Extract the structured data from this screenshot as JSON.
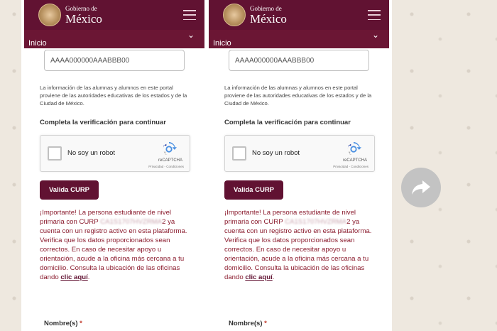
{
  "panels": [
    {
      "header": {
        "brand_small": "Gobierno de",
        "brand_big": "México"
      },
      "nav": {
        "label": "Inicio"
      },
      "curp_field": {
        "value": "AAAA000000AAABBB00"
      },
      "info_text": "La información de las alumnas y alumnos en este portal proviene de las autoridades educativas de los estados y de la Ciudad de México.",
      "verify_title": "Completa la verificación para continuar",
      "recaptcha": {
        "label": "No soy un robot",
        "brand": "reCAPTCHA",
        "links": "Privacidad - Condiciones"
      },
      "button": {
        "label": "Valida CURP"
      },
      "notice": {
        "part1": "¡Importante! La persona estudiante de nivel primaria con CURP ",
        "curp_blurred": "CA1S1707HVZRMA",
        "curp_tail": "2",
        "part2": " ya cuenta con un registro activo en esta plataforma. Verifica que los datos proporcionados sean correctos. En caso de necesitar apoyo u orientación, acude a la oficina más cercana a tu domicilio. Consulta la ubicación de las oficinas dando ",
        "link": "clic aquí",
        "end": "."
      },
      "form": {
        "nombre_label": "Nombre(s)",
        "required_mark": "*"
      }
    },
    {
      "header": {
        "brand_small": "Gobierno de",
        "brand_big": "México"
      },
      "nav": {
        "label": "Inicio"
      },
      "curp_field": {
        "value": "AAAA000000AAABBB00"
      },
      "info_text": "La información de las alumnas y alumnos en este portal proviene de las autoridades educativas de los estados y de la Ciudad de México.",
      "verify_title": "Completa la verificación para continuar",
      "recaptcha": {
        "label": "No soy un robot",
        "brand": "reCAPTCHA",
        "links": "Privacidad - Condiciones"
      },
      "button": {
        "label": "Valida CURP"
      },
      "notice": {
        "part1": "¡Importante! La persona estudiante de nivel primaria con CURP ",
        "curp_blurred": "CA1S1707HVZRMA",
        "curp_tail": "2",
        "part2": " ya cuenta con un registro activo en esta plataforma. Verifica que los datos proporcionados sean correctos. En caso de necesitar apoyo u orientación, acude a la oficina más cercana a tu domicilio. Consulta la ubicación de las oficinas dando ",
        "link": "clic aquí",
        "end": "."
      },
      "form": {
        "nombre_label": "Nombre(s)",
        "required_mark": "*"
      }
    }
  ],
  "colors": {
    "brand": "#611232",
    "notice": "#8b1c2e",
    "background": "#eee8df"
  },
  "icons": {
    "share": "forward-arrow-icon"
  }
}
